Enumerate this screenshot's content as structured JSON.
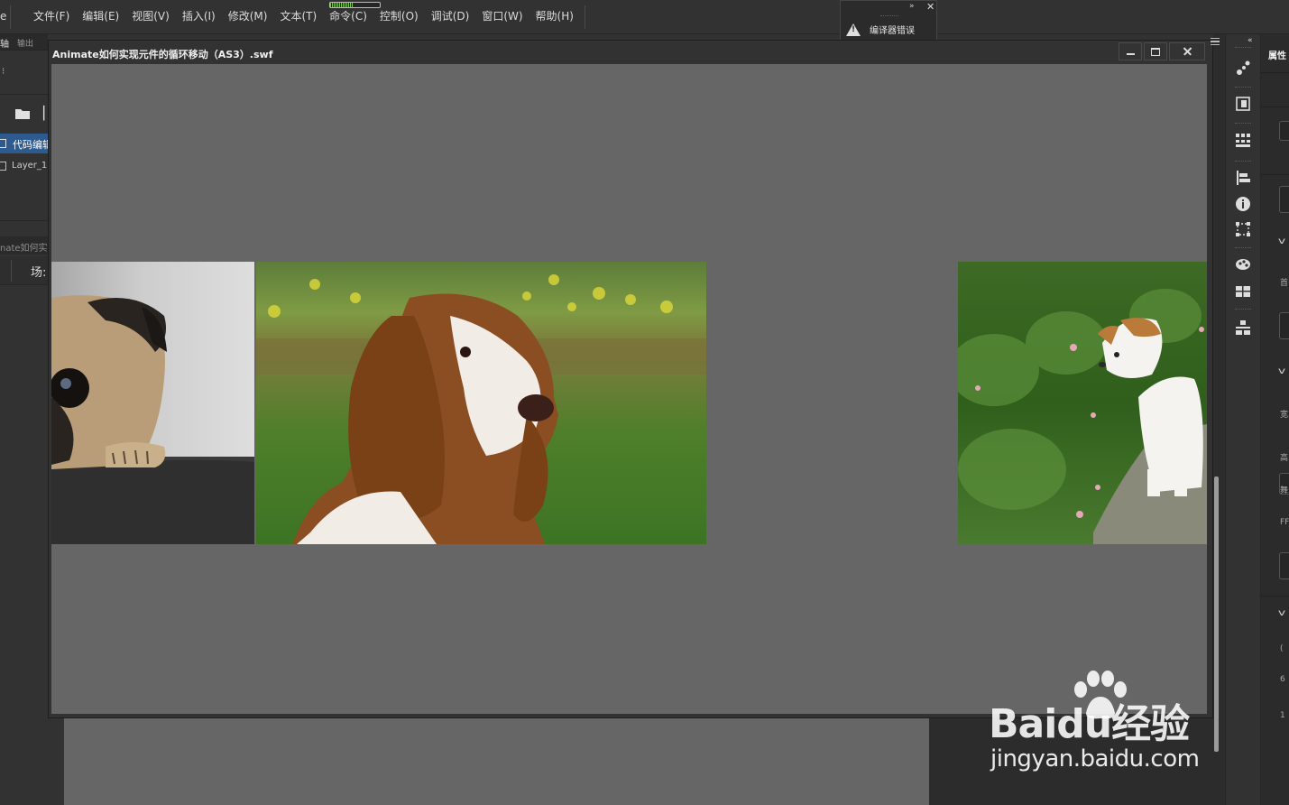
{
  "menubar": {
    "app_edge": "e",
    "items": [
      "文件(F)",
      "编辑(E)",
      "视图(V)",
      "插入(I)",
      "修改(M)",
      "文本(T)",
      "命令(C)",
      "控制(O)",
      "调试(D)",
      "窗口(W)",
      "帮助(H)"
    ]
  },
  "progress": {
    "fraction": 0.45
  },
  "compiler_errors": {
    "label": "编译器错误"
  },
  "left_panel": {
    "tab_timeline": "轴",
    "tab_output": "输出",
    "layers": [
      {
        "name": "代码编辑",
        "selected": true
      },
      {
        "name": "Layer_1",
        "selected": false
      }
    ],
    "doc_tab": "nate如何实",
    "scene_label": "场:"
  },
  "swf_window": {
    "title": "Animate如何实现元件的循环移动（AS3）.swf"
  },
  "stage_images": [
    {
      "subject": "pug-peeking-photo"
    },
    {
      "subject": "basset-hound-photo"
    },
    {
      "subject": "puppy-on-grass-photo"
    }
  ],
  "properties_panel": {
    "title": "属性",
    "labels": [
      "首",
      "宽",
      "高",
      "舞",
      "FF",
      "(",
      "6",
      "1"
    ]
  },
  "watermark": {
    "brand": "Baidu经验",
    "url": "jingyan.baidu.com"
  },
  "colors": {
    "selected_layer": "#2d5b8f",
    "stage_bg": "#666666",
    "ui_bg": "#323232",
    "progress_green": "#7ecb4a"
  }
}
